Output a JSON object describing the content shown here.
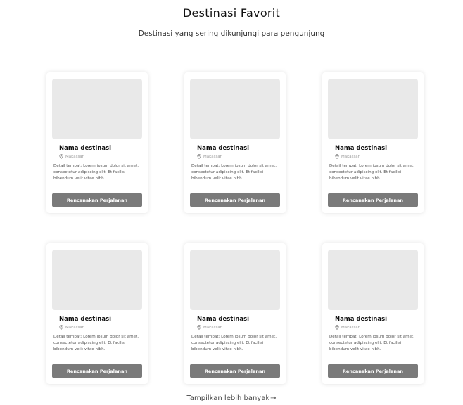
{
  "header": {
    "title": "Destinasi Favorit",
    "subtitle": "Destinasi yang sering dikunjungi para pengunjung"
  },
  "cards": [
    {
      "name": "Nama destinasi",
      "location": "Makassar",
      "description": "Detail tempat: Lorem ipsum dolor sit amet, consectetur adipiscing elit. Et facilisi bibendum velit vitae nibh.",
      "button": "Rencanakan Perjalanan"
    },
    {
      "name": "Nama destinasi",
      "location": "Makassar",
      "description": "Detail tempat: Lorem ipsum dolor sit amet, consectetur adipiscing elit. Et facilisi bibendum velit vitae nibh.",
      "button": "Rencanakan Perjalanan"
    },
    {
      "name": "Nama destinasi",
      "location": "Makassar",
      "description": "Detail tempat: Lorem ipsum dolor sit amet, consectetur adipiscing elit. Et facilisi bibendum velit vitae nibh.",
      "button": "Rencanakan Perjalanan"
    },
    {
      "name": "Nama destinasi",
      "location": "Makassar",
      "description": "Detail tempat: Lorem ipsum dolor sit amet, consectetur adipiscing elit. Et facilisi bibendum velit vitae nibh.",
      "button": "Rencanakan Perjalanan"
    },
    {
      "name": "Nama destinasi",
      "location": "Makassar",
      "description": "Detail tempat: Lorem ipsum dolor sit amet, consectetur adipiscing elit. Et facilisi bibendum velit vitae nibh.",
      "button": "Rencanakan Perjalanan"
    },
    {
      "name": "Nama destinasi",
      "location": "Makassar",
      "description": "Detail tempat: Lorem ipsum dolor sit amet, consectetur adipiscing elit. Et facilisi bibendum velit vitae nibh.",
      "button": "Rencanakan Perjalanan"
    }
  ],
  "footer": {
    "show_more_label": "Tampilkan lebih banyak",
    "show_more_icon": "arrow-right-icon"
  },
  "colors": {
    "button_bg": "#7a7a7a",
    "image_placeholder": "#e9e9e9",
    "text_primary": "#111111"
  }
}
